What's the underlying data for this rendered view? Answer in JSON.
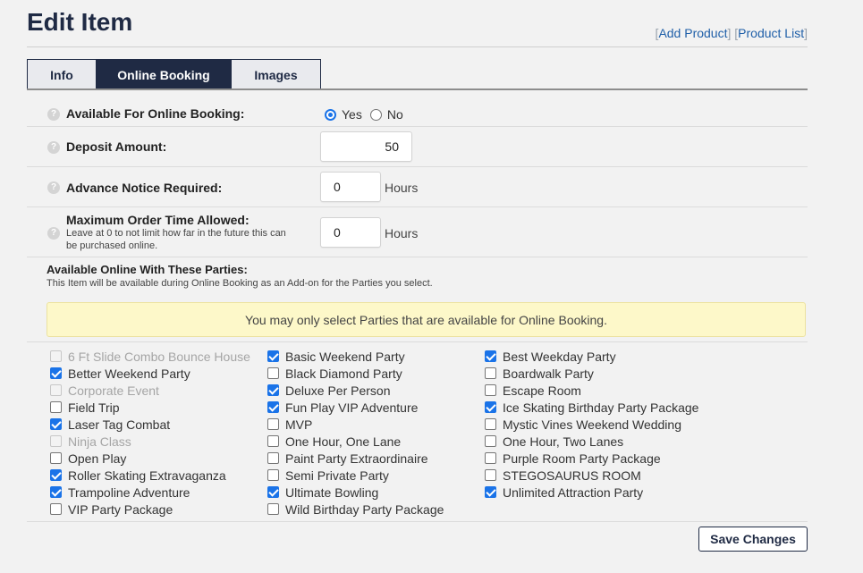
{
  "page": {
    "title": "Edit Item",
    "links": {
      "open": "[",
      "sep": "] [",
      "close": "]",
      "add_product": "Add Product",
      "product_list": "Product List"
    }
  },
  "tabs": [
    {
      "label": "Info",
      "active": false
    },
    {
      "label": "Online Booking",
      "active": true
    },
    {
      "label": "Images",
      "active": false
    }
  ],
  "form": {
    "available": {
      "label": "Available For Online Booking:",
      "yes": "Yes",
      "no": "No",
      "selected": "yes"
    },
    "deposit": {
      "label": "Deposit Amount:",
      "value": "50"
    },
    "advance": {
      "label": "Advance Notice Required:",
      "value": "0",
      "unit": "Hours"
    },
    "max_order": {
      "label": "Maximum Order Time Allowed:",
      "help": "Leave at 0 to not limit how far in the future this can be purchased online.",
      "value": "0",
      "unit": "Hours"
    }
  },
  "parties_section": {
    "title": "Available Online With These Parties:",
    "description": "This Item will be available during Online Booking as an Add-on for the Parties you select.",
    "notice": "You may only select Parties that are available for Online Booking."
  },
  "parties": {
    "col1": [
      {
        "label": "6 Ft Slide Combo Bounce House",
        "checked": false,
        "disabled": true
      },
      {
        "label": "Better Weekend Party",
        "checked": true,
        "disabled": false
      },
      {
        "label": "Corporate Event",
        "checked": false,
        "disabled": true
      },
      {
        "label": "Field Trip",
        "checked": false,
        "disabled": false
      },
      {
        "label": "Laser Tag Combat",
        "checked": true,
        "disabled": false
      },
      {
        "label": "Ninja Class",
        "checked": false,
        "disabled": true
      },
      {
        "label": "Open Play",
        "checked": false,
        "disabled": false
      },
      {
        "label": "Roller Skating Extravaganza",
        "checked": true,
        "disabled": false
      },
      {
        "label": "Trampoline Adventure",
        "checked": true,
        "disabled": false
      },
      {
        "label": "VIP Party Package",
        "checked": false,
        "disabled": false
      }
    ],
    "col2": [
      {
        "label": "Basic Weekend Party",
        "checked": true,
        "disabled": false
      },
      {
        "label": "Black Diamond Party",
        "checked": false,
        "disabled": false
      },
      {
        "label": "Deluxe Per Person",
        "checked": true,
        "disabled": false
      },
      {
        "label": "Fun Play VIP Adventure",
        "checked": true,
        "disabled": false
      },
      {
        "label": "MVP",
        "checked": false,
        "disabled": false
      },
      {
        "label": "One Hour, One Lane",
        "checked": false,
        "disabled": false
      },
      {
        "label": "Paint Party Extraordinaire",
        "checked": false,
        "disabled": false
      },
      {
        "label": "Semi Private Party",
        "checked": false,
        "disabled": false
      },
      {
        "label": "Ultimate Bowling",
        "checked": true,
        "disabled": false
      },
      {
        "label": "Wild Birthday Party Package",
        "checked": false,
        "disabled": false
      }
    ],
    "col3": [
      {
        "label": "Best Weekday Party",
        "checked": true,
        "disabled": false
      },
      {
        "label": "Boardwalk Party",
        "checked": false,
        "disabled": false
      },
      {
        "label": "Escape Room",
        "checked": false,
        "disabled": false
      },
      {
        "label": "Ice Skating Birthday Party Package",
        "checked": true,
        "disabled": false
      },
      {
        "label": "Mystic Vines Weekend Wedding",
        "checked": false,
        "disabled": false
      },
      {
        "label": "One Hour, Two Lanes",
        "checked": false,
        "disabled": false
      },
      {
        "label": "Purple Room Party Package",
        "checked": false,
        "disabled": false
      },
      {
        "label": "STEGOSAURUS ROOM",
        "checked": false,
        "disabled": false
      },
      {
        "label": "Unlimited Attraction Party",
        "checked": true,
        "disabled": false
      }
    ]
  },
  "actions": {
    "save": "Save Changes"
  },
  "colors": {
    "navy": "#1f2a44",
    "accent": "#1a73e8",
    "notice_bg": "#fdf8c9",
    "link": "#1f5fa8"
  },
  "icons": {
    "help": "question-mark-circle-icon",
    "check": "checkmark-icon"
  }
}
